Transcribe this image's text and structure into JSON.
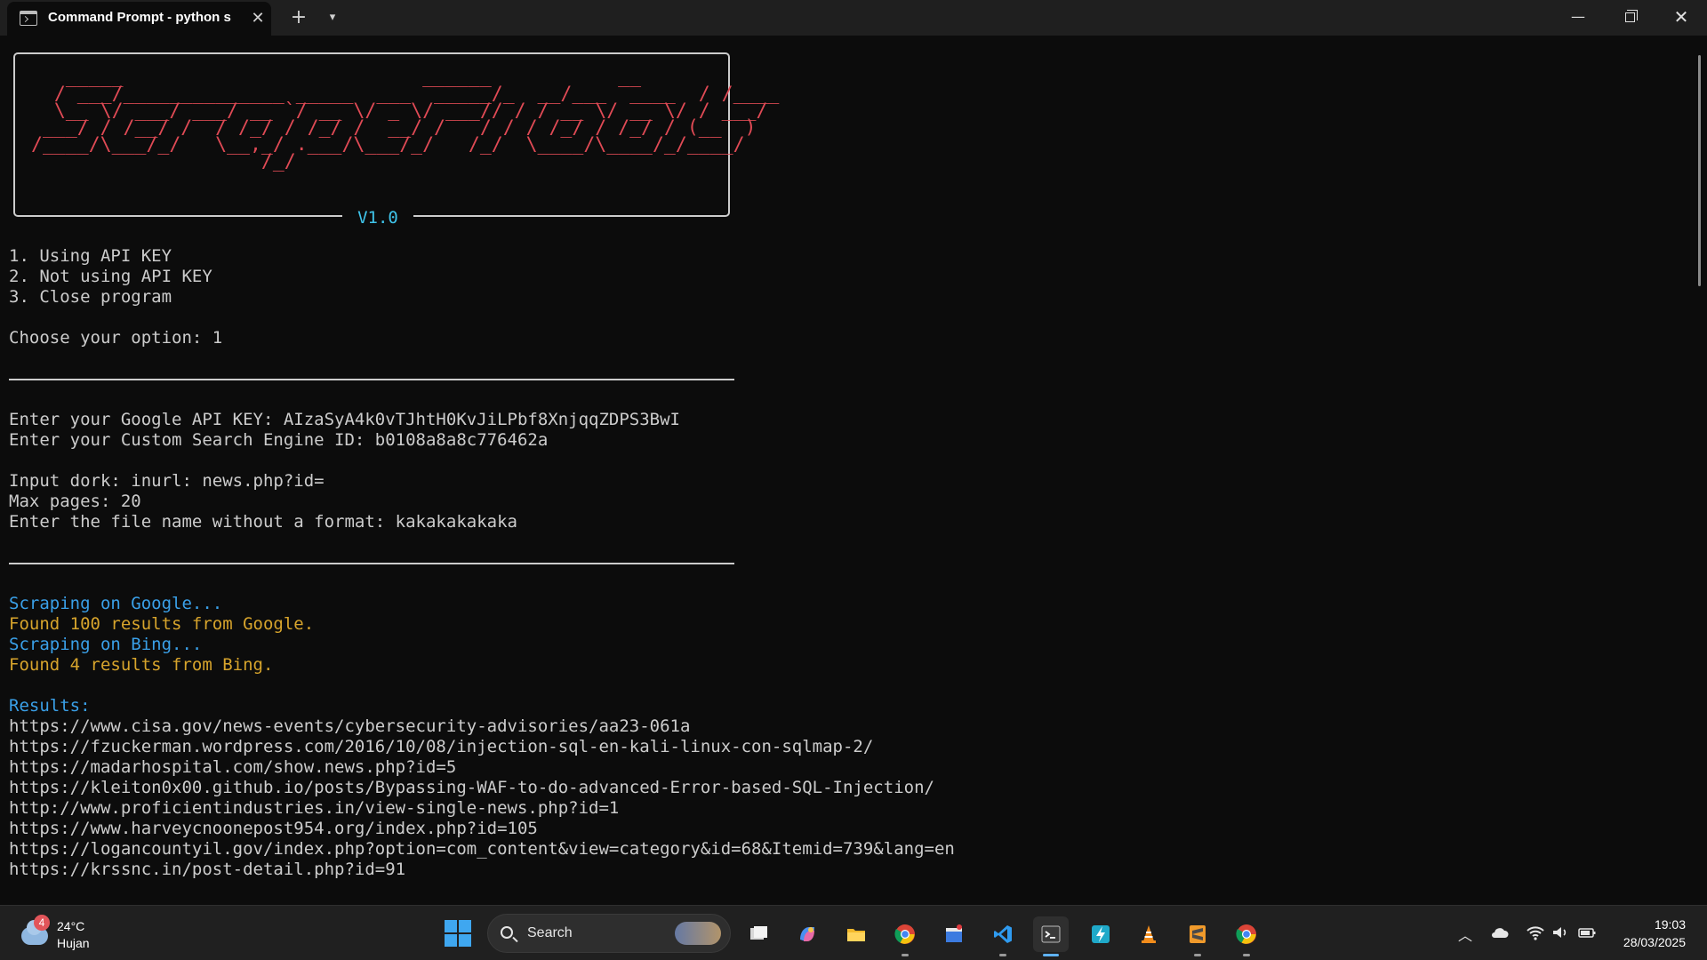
{
  "window": {
    "tab_title": "Command Prompt - python s",
    "new_tab_label": "+",
    "dropdown_label": "⌄",
    "minimize_label": "—",
    "close_label": "✕"
  },
  "terminal": {
    "banner_art": "   _____                          ______           __\n  / ___/______________ _____  ___  _____/_  __/___  ____  / /____\n  \\__ \\/ ___/ ___/ __ `/ __ \\/ _ \\/ ___// / / __ \\/ __ \\/ / ___/\n ___/ / /__/ /  / /_/ / /_/ /  __/ /   / / / /_/ / /_/ / (__  )\n/____/\\___/_/   \\__,_/ .___/\\___/_/   /_/  \\____/\\____/_/____/\n                    /_/",
    "version": "V1.0",
    "menu": [
      "1. Using API KEY",
      "2. Not using API KEY",
      "3. Close program"
    ],
    "choose_prompt": "Choose your option: 1",
    "api_key_line": "Enter your Google API KEY: AIzaSyA4k0vTJhtH0KvJiLPbf8XnjqqZDPS3BwI",
    "engine_id_line": "Enter your Custom Search Engine ID: b0108a8a8c776462a",
    "dork_line": "Input dork: inurl: news.php?id=",
    "max_pages_line": "Max pages: 20",
    "file_name_line": "Enter the file name without a format: kakakakakaka",
    "status_lines": [
      {
        "text": "Scraping on Google...",
        "color": "#3aa0e8"
      },
      {
        "text": "Found 100 results from Google.",
        "color": "#d7a42c"
      },
      {
        "text": "Scraping on Bing...",
        "color": "#3aa0e8"
      },
      {
        "text": "Found 4 results from Bing.",
        "color": "#d7a42c"
      }
    ],
    "results_label": "Results:",
    "results": [
      "https://www.cisa.gov/news-events/cybersecurity-advisories/aa23-061a",
      "https://fzuckerman.wordpress.com/2016/10/08/injection-sql-en-kali-linux-con-sqlmap-2/",
      "https://madarhospital.com/show.news.php?id=5",
      "https://kleiton0x00.github.io/posts/Bypassing-WAF-to-do-advanced-Error-based-SQL-Injection/",
      "http://www.proficientindustries.in/view-single-news.php?id=1",
      "https://www.harveycnoonepost954.org/index.php?id=105",
      "https://logancountyil.gov/index.php?option=com_content&view=category&id=68&Itemid=739&lang=en",
      "https://krssnc.in/post-detail.php?id=91"
    ]
  },
  "taskbar": {
    "weather_badge": "4",
    "temperature": "24°C",
    "condition": "Hujan",
    "search_label": "Search",
    "apps": [
      "task-view",
      "copilot",
      "file-explorer",
      "chrome",
      "media-editor",
      "vscode",
      "terminal",
      "powertoys",
      "vlc",
      "sublime-text",
      "chrome-profile"
    ],
    "clock_time": "19:03",
    "clock_date": "28/03/2025"
  }
}
